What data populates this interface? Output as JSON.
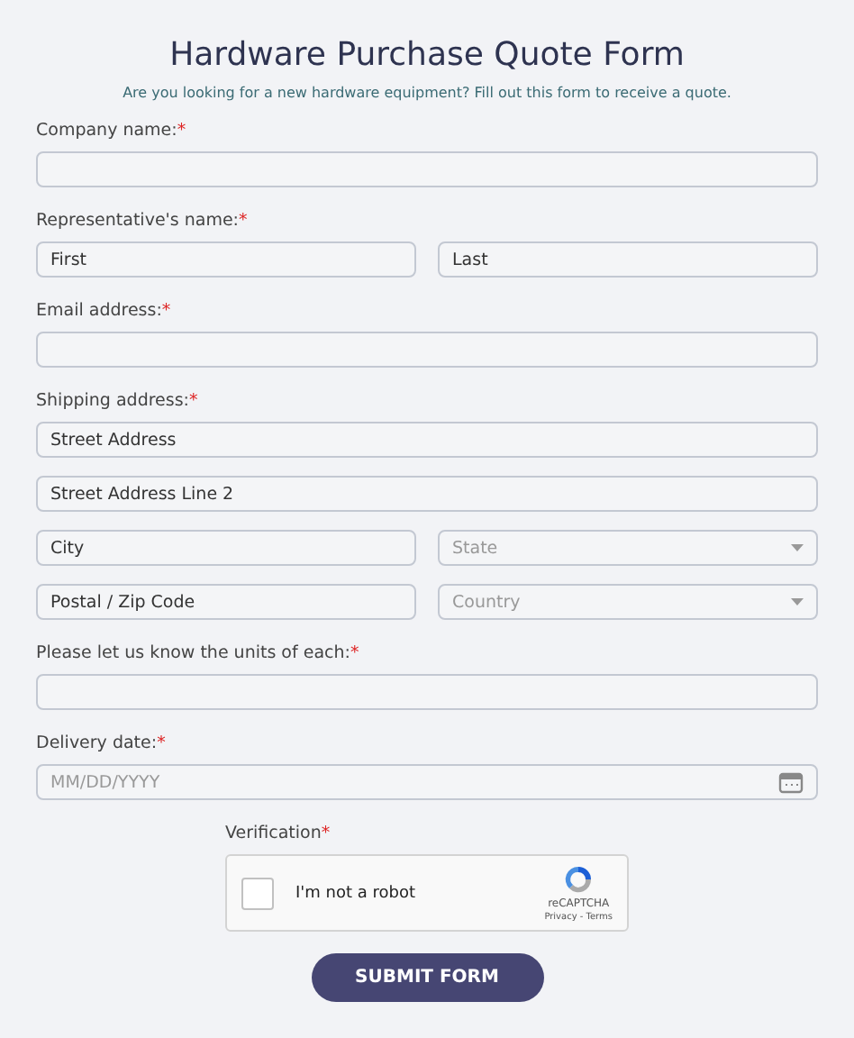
{
  "title": "Hardware Purchase Quote Form",
  "subtitle": "Are you looking for a new hardware equipment? Fill out this form to receive a quote.",
  "sections": [
    {
      "label": "Company name:",
      "mark": "*",
      "rows": [
        [
          {
            "kind": "text"
          }
        ]
      ]
    },
    {
      "label": "Representative's name:",
      "mark": "*",
      "rows": [
        [
          {
            "kind": "text",
            "placeholder": "First"
          },
          {
            "kind": "text",
            "placeholder": "Last"
          }
        ]
      ]
    },
    {
      "label": "Email address:",
      "mark": "*",
      "rows": [
        [
          {
            "kind": "text"
          }
        ]
      ]
    },
    {
      "label": "Shipping address:",
      "mark": "*",
      "rows": [
        [
          {
            "kind": "text",
            "placeholder": "Street Address"
          }
        ],
        [
          {
            "kind": "text",
            "placeholder": "Street Address Line 2"
          }
        ],
        [
          {
            "kind": "text",
            "placeholder": "City"
          },
          {
            "kind": "select",
            "placeholder": "State"
          }
        ],
        [
          {
            "kind": "text",
            "placeholder": "Postal / Zip Code"
          },
          {
            "kind": "select",
            "placeholder": "Country"
          }
        ]
      ]
    },
    {
      "label": "Please let us know the units of each:",
      "mark": "*",
      "rows": [
        [
          {
            "kind": "text"
          }
        ]
      ]
    },
    {
      "label": "Delivery date:",
      "mark": "*",
      "rows": [
        [
          {
            "kind": "date",
            "placeholder": "MM/DD/YYYY"
          }
        ]
      ]
    }
  ],
  "verification": {
    "label": "Verification",
    "mark": "*",
    "checked": false,
    "text": "I'm not a robot",
    "brand": "reCAPTCHA",
    "links": "Privacy - Terms"
  },
  "submit": "SUBMIT FORM"
}
